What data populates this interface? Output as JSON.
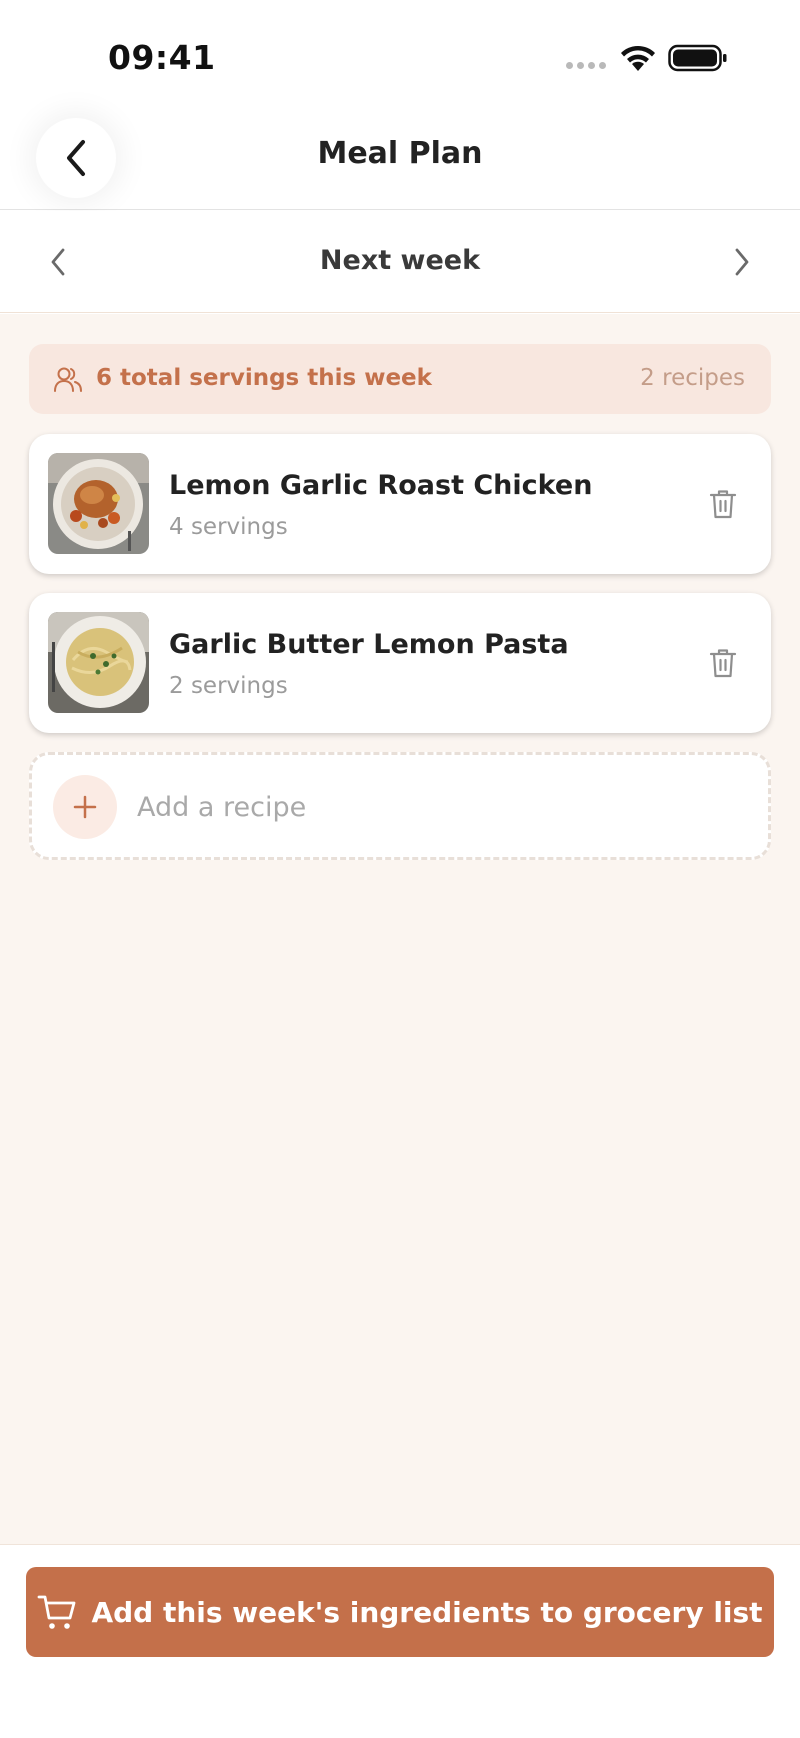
{
  "status_bar": {
    "time": "09:41"
  },
  "header": {
    "title": "Meal Plan"
  },
  "week_nav": {
    "label": "Next week"
  },
  "summary": {
    "servings_text": "6 total servings this week",
    "recipe_count": "2 recipes"
  },
  "recipes": [
    {
      "name": "Lemon Garlic Roast Chicken",
      "servings": "4 servings"
    },
    {
      "name": "Garlic Butter Lemon Pasta",
      "servings": "2 servings"
    }
  ],
  "add_recipe": {
    "label": "Add a recipe"
  },
  "footer": {
    "cta_label": "Add this week's ingredients to grocery list"
  },
  "colors": {
    "accent": "#c4704a",
    "background": "#fbf5f0",
    "summary_bg": "#f8e7df"
  }
}
